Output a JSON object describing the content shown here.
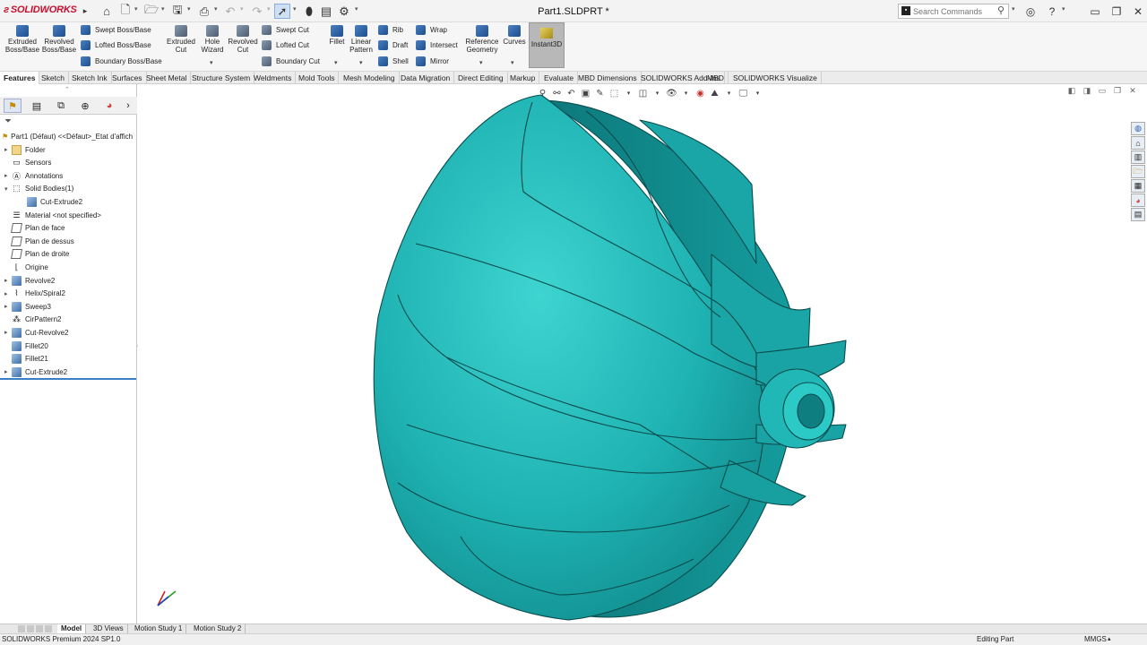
{
  "app": {
    "logo_text": "SOLIDWORKS",
    "document_title": "Part1.SLDPRT *"
  },
  "search": {
    "placeholder": "Search Commands"
  },
  "ribbon": {
    "features": {
      "extruded_boss": "Extruded Boss/Base",
      "revolved_boss": "Revolved Boss/Base",
      "swept_boss": "Swept Boss/Base",
      "lofted_boss": "Lofted Boss/Base",
      "boundary_boss": "Boundary Boss/Base",
      "extruded_cut": "Extruded Cut",
      "hole_wizard": "Hole Wizard",
      "revolved_cut": "Revolved Cut",
      "swept_cut": "Swept Cut",
      "lofted_cut": "Lofted Cut",
      "boundary_cut": "Boundary Cut",
      "fillet": "Fillet",
      "linear_pattern": "Linear Pattern",
      "rib": "Rib",
      "draft": "Draft",
      "shell": "Shell",
      "wrap": "Wrap",
      "intersect": "Intersect",
      "mirror": "Mirror",
      "reference_geometry": "Reference Geometry",
      "curves": "Curves",
      "instant3d": "Instant3D"
    }
  },
  "command_tabs": [
    {
      "label": "Features",
      "active": true
    },
    {
      "label": "Sketch"
    },
    {
      "label": "Sketch Ink"
    },
    {
      "label": "Surfaces"
    },
    {
      "label": "Sheet Metal"
    },
    {
      "label": "Structure System"
    },
    {
      "label": "Weldments"
    },
    {
      "label": "Mold Tools"
    },
    {
      "label": "Mesh Modeling"
    },
    {
      "label": "Data Migration"
    },
    {
      "label": "Direct Editing"
    },
    {
      "label": "Markup"
    },
    {
      "label": "Evaluate"
    },
    {
      "label": "MBD Dimensions"
    },
    {
      "label": "SOLIDWORKS Add-Ins"
    },
    {
      "label": "MBD"
    },
    {
      "label": "SOLIDWORKS Visualize"
    }
  ],
  "feature_tree": {
    "root": "Part1 (Défaut) <<Défaut>_Etat d'affich",
    "items": [
      {
        "label": "Folder",
        "icon": "folder-icon",
        "expandable": true
      },
      {
        "label": "Sensors",
        "icon": "sensors-icon",
        "expandable": false
      },
      {
        "label": "Annotations",
        "icon": "annotations-icon",
        "expandable": true
      },
      {
        "label": "Solid Bodies(1)",
        "icon": "solid-bodies-icon",
        "expandable": true,
        "expanded": true
      },
      {
        "label": "Cut-Extrude2",
        "icon": "body-icon",
        "indent": 1
      },
      {
        "label": "Material <not specified>",
        "icon": "material-icon"
      },
      {
        "label": "Plan de face",
        "icon": "plane-icon"
      },
      {
        "label": "Plan de dessus",
        "icon": "plane-icon"
      },
      {
        "label": "Plan de droite",
        "icon": "plane-icon"
      },
      {
        "label": "Origine",
        "icon": "origin-icon"
      },
      {
        "label": "Revolve2",
        "icon": "revolve-icon",
        "expandable": true
      },
      {
        "label": "Helix/Spiral2",
        "icon": "helix-icon",
        "expandable": true
      },
      {
        "label": "Sweep3",
        "icon": "sweep-icon",
        "expandable": true
      },
      {
        "label": "CirPattern2",
        "icon": "circular-pattern-icon"
      },
      {
        "label": "Cut-Revolve2",
        "icon": "cut-revolve-icon",
        "expandable": true
      },
      {
        "label": "Fillet20",
        "icon": "fillet-icon"
      },
      {
        "label": "Fillet21",
        "icon": "fillet-icon"
      },
      {
        "label": "Cut-Extrude2",
        "icon": "cut-extrude-icon",
        "expandable": true
      }
    ]
  },
  "bottom_tabs": [
    {
      "label": "Model",
      "active": true
    },
    {
      "label": "3D Views"
    },
    {
      "label": "Motion Study 1"
    },
    {
      "label": "Motion Study 2"
    }
  ],
  "status": {
    "product": "SOLIDWORKS Premium 2024 SP1.0",
    "mode": "Editing Part",
    "units": "MMGS"
  },
  "colors": {
    "model_base": "#20b5b5",
    "model_dark": "#0e7f80",
    "model_light": "#40d6d3",
    "accent": "#3a7fc4"
  }
}
